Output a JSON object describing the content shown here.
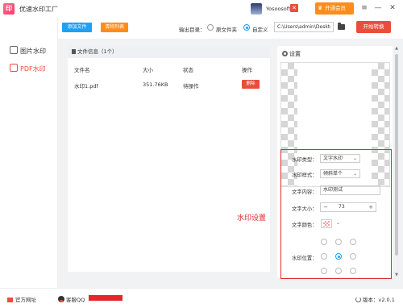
{
  "app": {
    "logo_glyph": "印",
    "title": "优速水印工厂"
  },
  "user": {
    "name": "Yosoosoft",
    "dropdown_glyph": "✕"
  },
  "vip": {
    "label": "开通会员",
    "crown_glyph": "♛"
  },
  "window": {
    "menu": "≡",
    "minimize": "—",
    "close": "✕"
  },
  "sidebar": {
    "items": [
      {
        "label": "图片水印",
        "active": false
      },
      {
        "label": "PDF水印",
        "active": true
      }
    ]
  },
  "toolbar": {
    "add_label": "添加文件",
    "clear_label": "清除列表",
    "output_label": "输出目录：",
    "radio_original": "原文件夹",
    "radio_custom": "自定义",
    "selected_output": "自定义",
    "path_value": "C:\\Users\\admin\\Deskto",
    "start_label": "开始转换"
  },
  "files": {
    "header": "文件信息（1个）",
    "columns": [
      "文件名",
      "大小",
      "状态",
      "操作"
    ],
    "rows": [
      {
        "name": "水印1.pdf",
        "size": "351.76KB",
        "status": "待操作",
        "action": "删除"
      }
    ]
  },
  "settings": {
    "title": "设置",
    "type_label": "水印类型：",
    "type_value": "文字水印",
    "style_label": "水印样式：",
    "style_value": "倾斜单个",
    "content_label": "文字内容：",
    "content_value": "水印测试",
    "size_label": "文字大小：",
    "size_value": "73",
    "minus": "−",
    "plus": "+",
    "color_label": "文字颜色：",
    "position_label": "水印位置：",
    "position_selected": "middle-center"
  },
  "callout": "水印设置",
  "statusbar": {
    "site_label": "官方网址",
    "qq_label": "客服QQ",
    "version": "版本：v2.0.1"
  },
  "colors": {
    "accent_red": "#e94e3c",
    "blue": "#1ea0f5",
    "orange": "#ff8c1a",
    "highlight_box": "#e4282a"
  }
}
